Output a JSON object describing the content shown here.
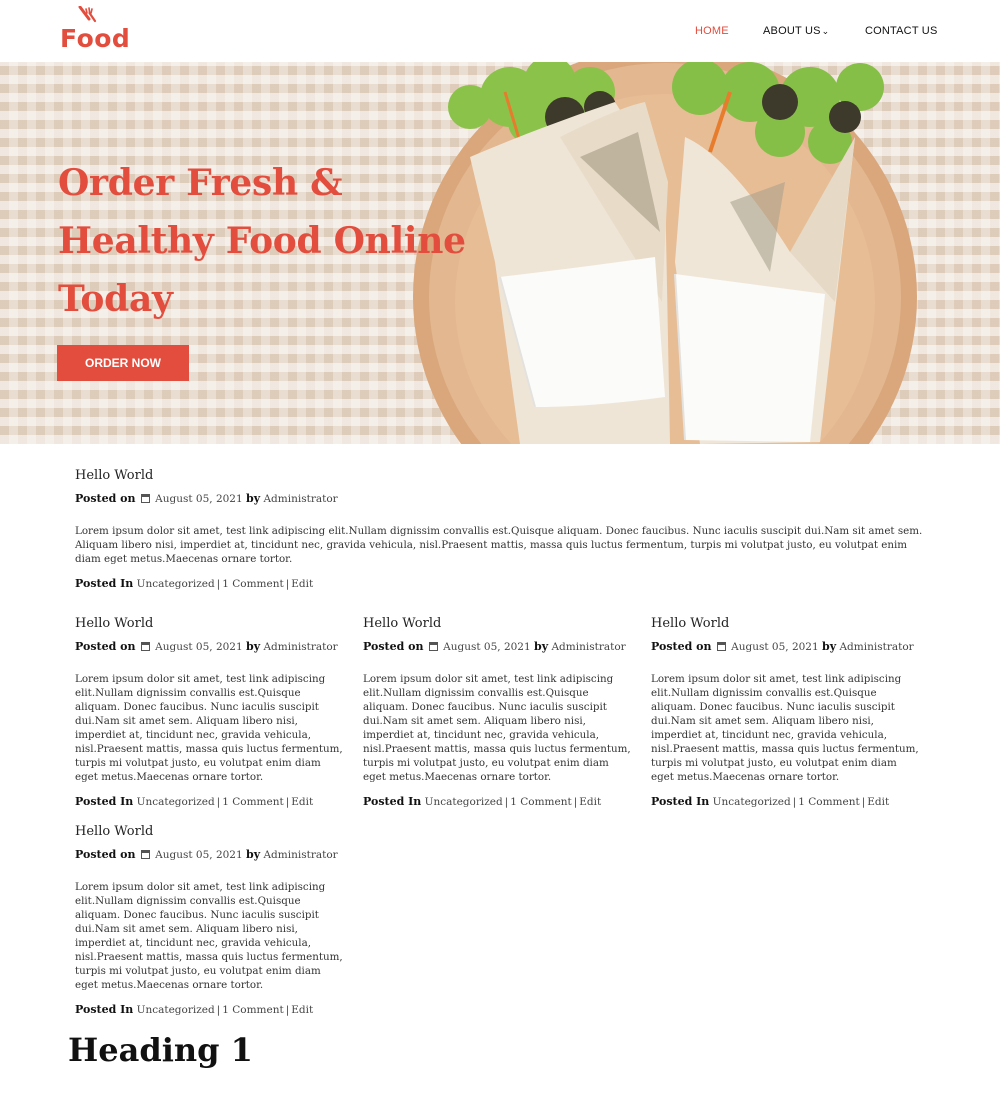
{
  "brand": {
    "logo_text": "Food",
    "accent": "#e24d3d"
  },
  "nav": {
    "home": "HOME",
    "about": "ABOUT US",
    "contact": "CONTACT US"
  },
  "hero": {
    "title": "Order Fresh & Healthy Food Online Today",
    "button": "ORDER NOW"
  },
  "posts": [
    {
      "title": "Hello World",
      "posted_on": "Posted on",
      "date": "August 05, 2021",
      "by": "by",
      "author": "Administrator",
      "body": "Lorem ipsum dolor sit amet, test link adipiscing elit.Nullam dignissim convallis est.Quisque aliquam. Donec faucibus. Nunc iaculis suscipit dui.Nam sit amet sem. Aliquam libero nisi, imperdiet at, tincidunt nec, gravida vehicula, nisl.Praesent mattis, massa quis luctus fermentum, turpis mi volutpat justo, eu volutpat enim diam eget metus.Maecenas ornare tortor.",
      "posted_in": "Posted In",
      "category": "Uncategorized",
      "comments": "1 Comment",
      "edit": "Edit"
    },
    {
      "title": "Hello World",
      "posted_on": "Posted on",
      "date": "August 05, 2021",
      "by": "by",
      "author": "Administrator",
      "body": "Lorem ipsum dolor sit amet, test link adipiscing elit.Nullam dignissim convallis est.Quisque aliquam. Donec faucibus. Nunc iaculis suscipit dui.Nam sit amet sem. Aliquam libero nisi, imperdiet at, tincidunt nec, gravida vehicula, nisl.Praesent mattis, massa quis luctus fermentum, turpis mi volutpat justo, eu volutpat enim diam eget metus.Maecenas ornare tortor.",
      "posted_in": "Posted In",
      "category": "Uncategorized",
      "comments": "1 Comment",
      "edit": "Edit"
    },
    {
      "title": "Hello World",
      "posted_on": "Posted on",
      "date": "August 05, 2021",
      "by": "by",
      "author": "Administrator",
      "body": "Lorem ipsum dolor sit amet, test link adipiscing elit.Nullam dignissim convallis est.Quisque aliquam. Donec faucibus. Nunc iaculis suscipit dui.Nam sit amet sem. Aliquam libero nisi, imperdiet at, tincidunt nec, gravida vehicula, nisl.Praesent mattis, massa quis luctus fermentum, turpis mi volutpat justo, eu volutpat enim diam eget metus.Maecenas ornare tortor.",
      "posted_in": "Posted In",
      "category": "Uncategorized",
      "comments": "1 Comment",
      "edit": "Edit"
    },
    {
      "title": "Hello World",
      "posted_on": "Posted on",
      "date": "August 05, 2021",
      "by": "by",
      "author": "Administrator",
      "body": "Lorem ipsum dolor sit amet, test link adipiscing elit.Nullam dignissim convallis est.Quisque aliquam. Donec faucibus. Nunc iaculis suscipit dui.Nam sit amet sem. Aliquam libero nisi, imperdiet at, tincidunt nec, gravida vehicula, nisl.Praesent mattis, massa quis luctus fermentum, turpis mi volutpat justo, eu volutpat enim diam eget metus.Maecenas ornare tortor.",
      "posted_in": "Posted In",
      "category": "Uncategorized",
      "comments": "1 Comment",
      "edit": "Edit"
    },
    {
      "title": "Hello World",
      "posted_on": "Posted on",
      "date": "August 05, 2021",
      "by": "by",
      "author": "Administrator",
      "body": "Lorem ipsum dolor sit amet, test link adipiscing elit.Nullam dignissim convallis est.Quisque aliquam. Donec faucibus. Nunc iaculis suscipit dui.Nam sit amet sem. Aliquam libero nisi, imperdiet at, tincidunt nec, gravida vehicula, nisl.Praesent mattis, massa quis luctus fermentum, turpis mi volutpat justo, eu volutpat enim diam eget metus.Maecenas ornare tortor.",
      "posted_in": "Posted In",
      "category": "Uncategorized",
      "comments": "1 Comment",
      "edit": "Edit"
    }
  ],
  "heading1": "Heading 1"
}
